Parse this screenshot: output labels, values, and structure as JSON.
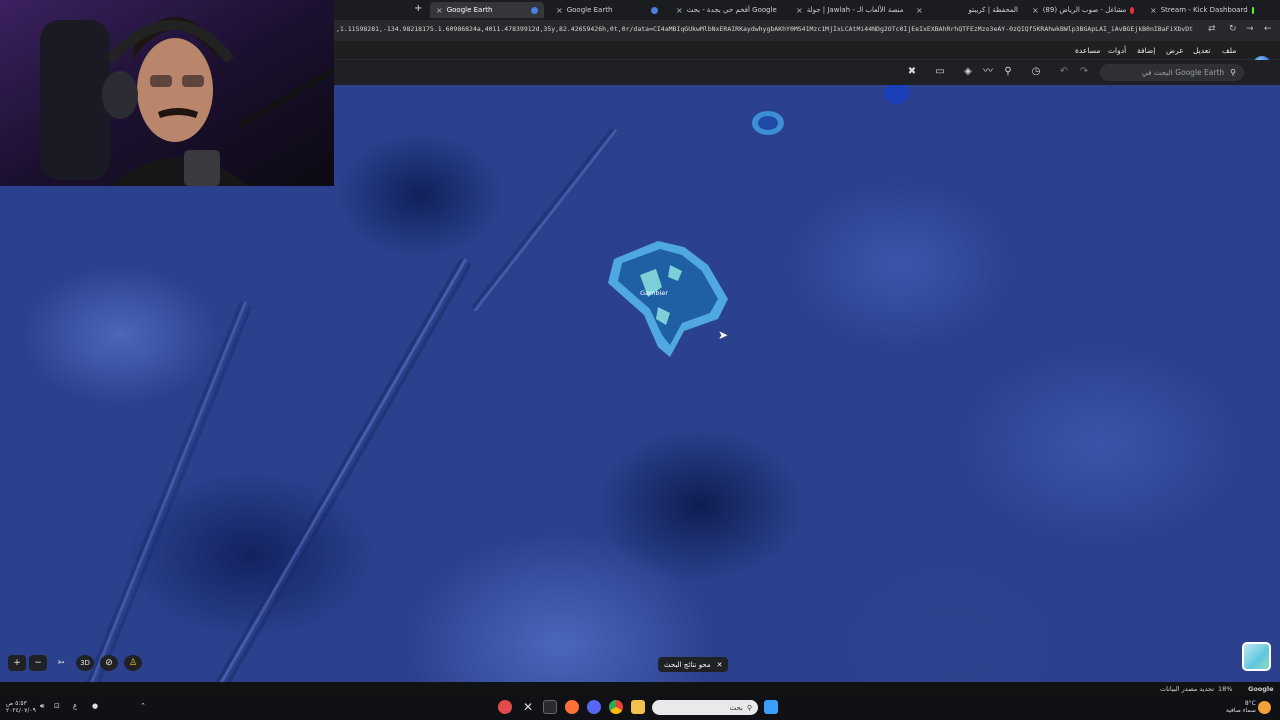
{
  "browser": {
    "tabs": [
      {
        "title": "Google Earth",
        "active": true
      },
      {
        "title": "Google Earth",
        "active": false
      },
      {
        "title": "أفخم حي بجدة - بحث Google",
        "active": false
      },
      {
        "title": "جولة | Jawlah - منصة الألعاب الـ",
        "active": false
      },
      {
        "title": "المحفظة | كريبتو",
        "active": false
      },
      {
        "title": "(89) مشاغل - صوب الرياض",
        "active": false
      },
      {
        "title": "Stream - Kick Dashboard",
        "active": false
      }
    ],
    "url": ",1.11598281,-134.98218175.1.60986824a,4011.47839912d,35y,82.42659426h,0t,0r/data=CI4aMBIqGUkwMlbNxERAIRKaydwhygbAKhY0MS41Mzc1MjIxLCAtMi44NDg2OTc0IjEeIxEXBAhRrhQTFEzMzo3eAY-0zQIQf5KRAhwkBWlp3BGApLAI_iAvBGEjkB0nIBaFiXbvDt",
    "colors": {
      "tabbar": "#1b1c1f",
      "active_tab": "#35363a",
      "kick": "#53fc18"
    }
  },
  "earth": {
    "menu": [
      "ملف",
      "تعديل",
      "عرض",
      "إضافة",
      "أدوات",
      "مساعدة"
    ],
    "search_placeholder": "البحث في Google Earth",
    "island_label": "Gambier",
    "clear_search_label": "محو نتائج البحث",
    "view_3d_label": "3D",
    "zoom_in_label": "+",
    "zoom_out_label": "−",
    "scale_label": "18%",
    "data_update_label": "تحديد مصدر البيانات",
    "google_label": "Google",
    "tool_icons": [
      "pin-tool-icon",
      "ruler-icon",
      "layers-icon",
      "path-icon",
      "placemark-icon",
      "history-icon",
      "undo-icon",
      "redo-icon"
    ]
  },
  "taskbar": {
    "search_placeholder": "بحث",
    "weather_temp": "8°C",
    "weather_desc": "سماء صافية",
    "clock_time": "٥:٥٣ ص",
    "clock_date": "٢٠٢٤/٠٧/٠٩",
    "lang": "ع"
  }
}
